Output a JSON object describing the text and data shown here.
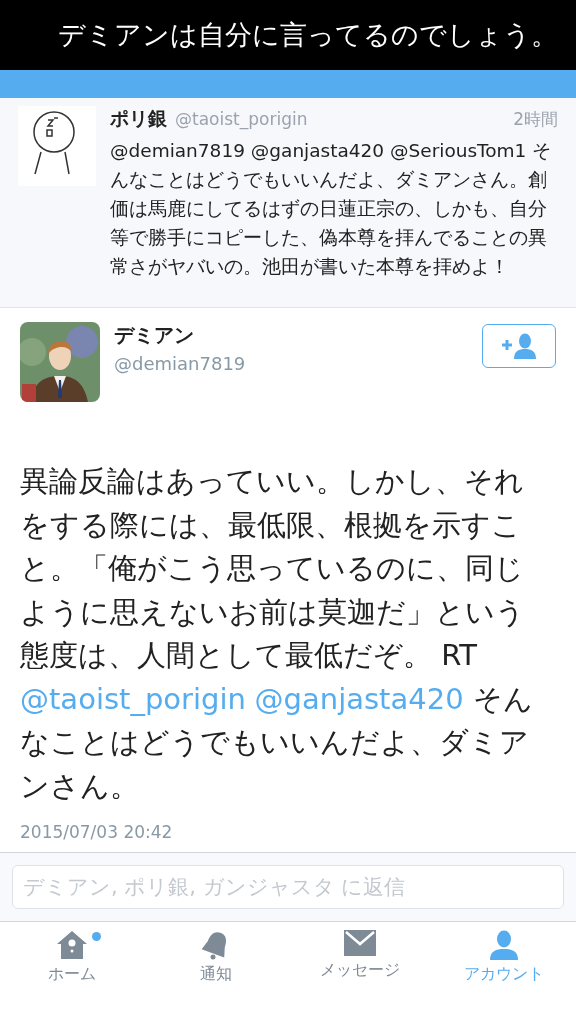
{
  "caption": "デミアンは自分に言ってるのでしょう。",
  "quoted_tweet": {
    "name": "ポリ銀",
    "handle": "@taoist_porigin",
    "time": "2時間",
    "body": "@demian7819 @ganjasta420 @SeriousTom1 そんなことはどうでもいいんだよ、ダミアンさん。創価は馬鹿にしてるはずの日蓮正宗の、しかも、自分等で勝手にコピーした、偽本尊を拝んでることの異常さがヤバいの。池田が書いた本尊を拝めよ！"
  },
  "tweet": {
    "name": "デミアン",
    "handle": "@demian7819",
    "body": [
      {
        "kind": "text",
        "text": "異論反論はあっていい。しかし、それをする際には、最低限、根拠を示すこと。「俺がこう思っているのに、同じように思えないお前は莫迦だ」という態度は、人間として最低だぞ。 RT "
      },
      {
        "kind": "mention",
        "text": "@taoist_porigin"
      },
      {
        "kind": "mention",
        "text": "@ganjasta420"
      },
      {
        "kind": "text",
        "text": " そんなことはどうでもいいんだよ、ダミアンさん。"
      }
    ],
    "timestamp": "2015/07/03 20:42"
  },
  "reply": {
    "placeholder": "デミアン, ポリ銀, ガンジャスタ に返信"
  },
  "tabs": [
    {
      "kind": "home",
      "label": "ホーム",
      "selected": false,
      "badge": true
    },
    {
      "kind": "bell",
      "label": "通知",
      "selected": false,
      "badge": false
    },
    {
      "kind": "mail",
      "label": "メッセージ",
      "selected": false,
      "badge": false
    },
    {
      "kind": "person",
      "label": "アカウント",
      "selected": true,
      "badge": false
    }
  ]
}
